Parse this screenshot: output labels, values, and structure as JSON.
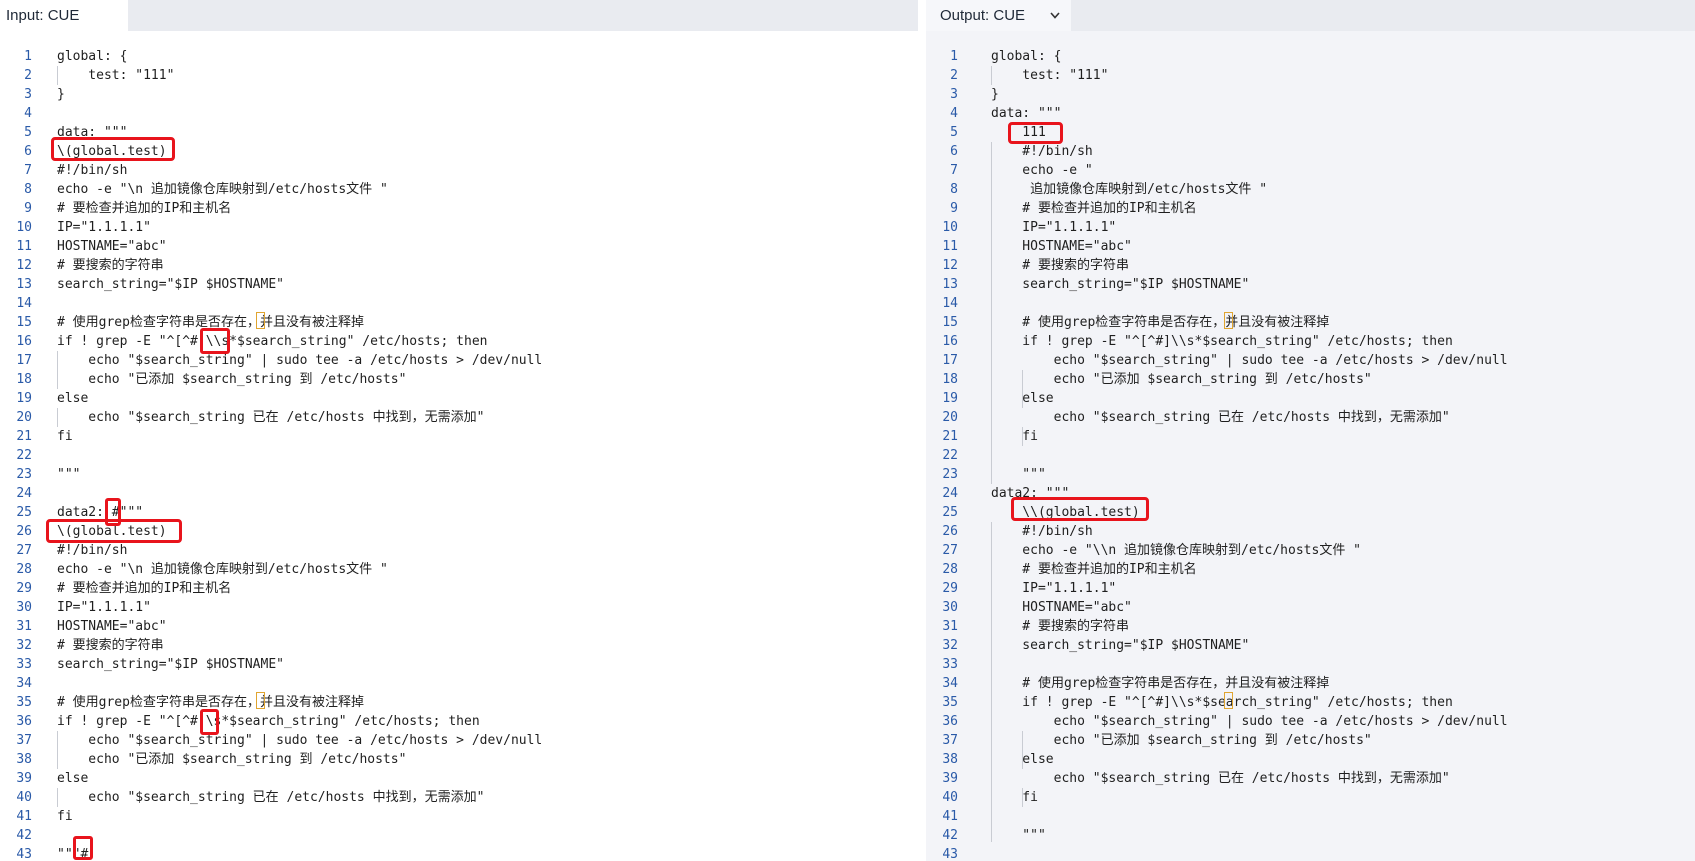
{
  "input": {
    "tab_label": "Input: CUE",
    "lines": [
      "global: {",
      "    test: \"111\"",
      "}",
      "",
      "data: \"\"\"",
      "\\(global.test)",
      "#!/bin/sh",
      "echo -e \"\\n 追加镜像仓库映射到/etc/hosts文件 \"",
      "# 要检查并追加的IP和主机名",
      "IP=\"1.1.1.1\"",
      "HOSTNAME=\"abc\"",
      "# 要搜索的字符串",
      "search_string=\"$IP $HOSTNAME\"",
      "",
      "# 使用grep检查字符串是否存在，并且没有被注释掉",
      "if ! grep -E \"^[^#]\\\\s*$search_string\" /etc/hosts; then",
      "    echo \"$search_string\" | sudo tee -a /etc/hosts > /dev/null",
      "    echo \"已添加 $search_string 到 /etc/hosts\"",
      "else",
      "    echo \"$search_string 已在 /etc/hosts 中找到，无需添加\"",
      "fi",
      "",
      "\"\"\"",
      "",
      "data2: #\"\"\"",
      "\\(global.test)",
      "#!/bin/sh",
      "echo -e \"\\n 追加镜像仓库映射到/etc/hosts文件 \"",
      "# 要检查并追加的IP和主机名",
      "IP=\"1.1.1.1\"",
      "HOSTNAME=\"abc\"",
      "# 要搜索的字符串",
      "search_string=\"$IP $HOSTNAME\"",
      "",
      "# 使用grep检查字符串是否存在，并且没有被注释掉",
      "if ! grep -E \"^[^#]\\s*$search_string\" /etc/hosts; then",
      "    echo \"$search_string\" | sudo tee -a /etc/hosts > /dev/null",
      "    echo \"已添加 $search_string 到 /etc/hosts\"",
      "else",
      "    echo \"$search_string 已在 /etc/hosts 中找到，无需添加\"",
      "fi",
      "",
      "\"\"\"#"
    ]
  },
  "output": {
    "tab_label": "Output: CUE",
    "tab_icon": "chevron-down-icon",
    "lines": [
      "global: {",
      "    test: \"111\"",
      "}",
      "data: \"\"\"",
      "    111",
      "    #!/bin/sh",
      "    echo -e \"",
      "     追加镜像仓库映射到/etc/hosts文件 \"",
      "    # 要检查并追加的IP和主机名",
      "    IP=\"1.1.1.1\"",
      "    HOSTNAME=\"abc\"",
      "    # 要搜索的字符串",
      "    search_string=\"$IP $HOSTNAME\"",
      "",
      "    # 使用grep检查字符串是否存在，并且没有被注释掉",
      "    if ! grep -E \"^[^#]\\\\s*$search_string\" /etc/hosts; then",
      "        echo \"$search_string\" | sudo tee -a /etc/hosts > /dev/null",
      "        echo \"已添加 $search_string 到 /etc/hosts\"",
      "    else",
      "        echo \"$search_string 已在 /etc/hosts 中找到，无需添加\"",
      "    fi",
      "",
      "    \"\"\"",
      "data2: \"\"\"",
      "    \\\\(global.test)",
      "    #!/bin/sh",
      "    echo -e \"\\\\n 追加镜像仓库映射到/etc/hosts文件 \"",
      "    # 要检查并追加的IP和主机名",
      "    IP=\"1.1.1.1\"",
      "    HOSTNAME=\"abc\"",
      "    # 要搜索的字符串",
      "    search_string=\"$IP $HOSTNAME\"",
      "",
      "    # 使用grep检查字符串是否存在，并且没有被注释掉",
      "    if ! grep -E \"^[^#]\\\\s*$search_string\" /etc/hosts; then",
      "        echo \"$search_string\" | sudo tee -a /etc/hosts > /dev/null",
      "        echo \"已添加 $search_string 到 /etc/hosts\"",
      "    else",
      "        echo \"$search_string 已在 /etc/hosts 中找到，无需添加\"",
      "    fi",
      "",
      "    \"\"\"",
      ""
    ]
  },
  "colors": {
    "highlight_border": "#e8141c",
    "line_number": "#2a5aa8",
    "ambiguous_char_box": "#e0a530",
    "output_background": "#f3f4f8"
  }
}
